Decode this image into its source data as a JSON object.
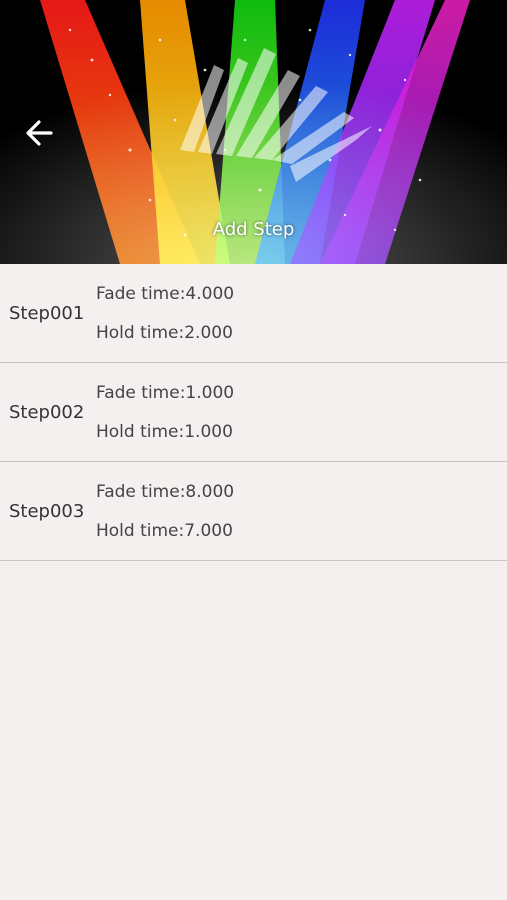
{
  "header": {
    "title": "Add Step",
    "back_icon": "arrow-left-icon",
    "logo_icon": "fan-logo-icon"
  },
  "steps": [
    {
      "name": "Step001",
      "fade": "Fade time:4.000",
      "hold": "Hold time:2.000"
    },
    {
      "name": "Step002",
      "fade": "Fade time:1.000",
      "hold": "Hold time:1.000"
    },
    {
      "name": "Step003",
      "fade": "Fade time:8.000",
      "hold": "Hold time:7.000"
    }
  ],
  "colors": {
    "background": "#f4f0ef",
    "divider": "#c9c5c4",
    "beams": [
      "#ff2a1a",
      "#ffd400",
      "#22ee22",
      "#2244ff",
      "#a020f0",
      "#ff22cc"
    ]
  }
}
